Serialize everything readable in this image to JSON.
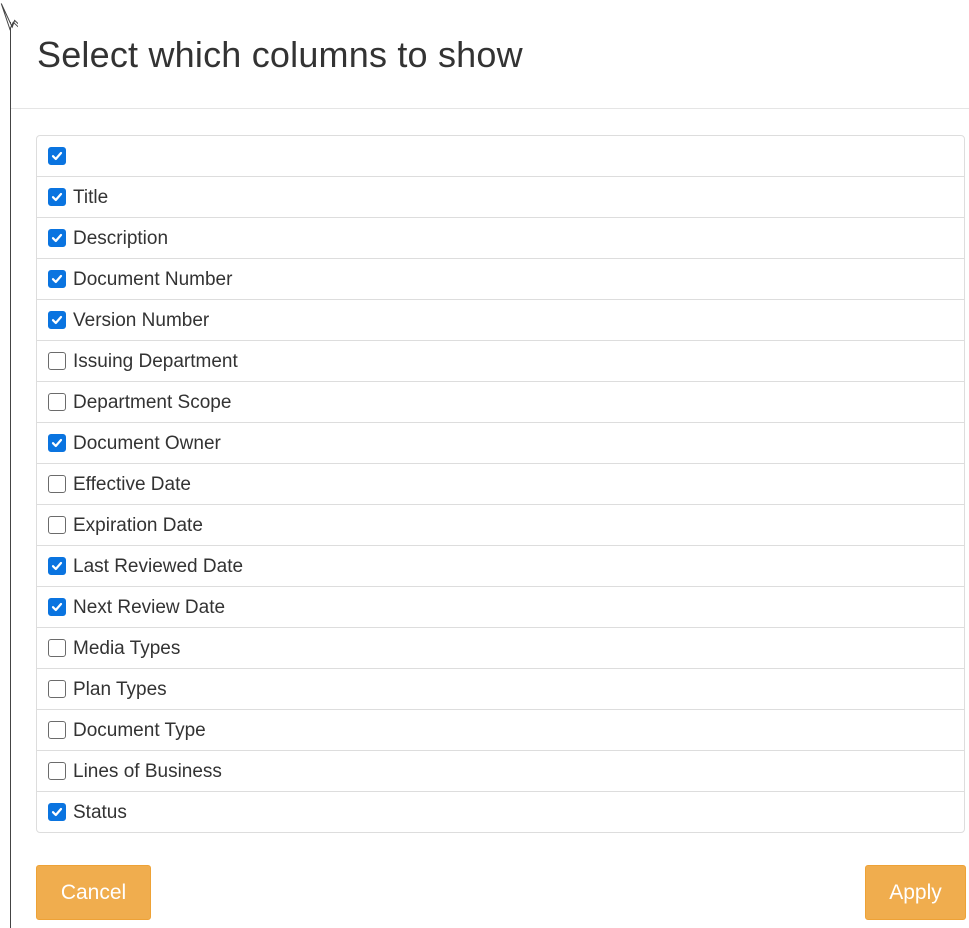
{
  "dialog": {
    "title": "Select which columns to show"
  },
  "columns": [
    {
      "label": "",
      "checked": true
    },
    {
      "label": "Title",
      "checked": true
    },
    {
      "label": "Description",
      "checked": true
    },
    {
      "label": "Document Number",
      "checked": true
    },
    {
      "label": "Version Number",
      "checked": true
    },
    {
      "label": "Issuing Department",
      "checked": false
    },
    {
      "label": "Department Scope",
      "checked": false
    },
    {
      "label": "Document Owner",
      "checked": true
    },
    {
      "label": "Effective Date",
      "checked": false
    },
    {
      "label": "Expiration Date",
      "checked": false
    },
    {
      "label": "Last Reviewed Date",
      "checked": true
    },
    {
      "label": "Next Review Date",
      "checked": true
    },
    {
      "label": "Media Types",
      "checked": false
    },
    {
      "label": "Plan Types",
      "checked": false
    },
    {
      "label": "Document Type",
      "checked": false
    },
    {
      "label": "Lines of Business",
      "checked": false
    },
    {
      "label": "Status",
      "checked": true
    }
  ],
  "buttons": {
    "cancel_label": "Cancel",
    "apply_label": "Apply"
  },
  "icons": {
    "checkbox": "checkbox-icon",
    "cursor": "mouse-pointer-icon"
  },
  "colors": {
    "checkbox_checked": "#0a74e0",
    "button_warning": "#f0ad4e",
    "border": "#dddddd"
  }
}
